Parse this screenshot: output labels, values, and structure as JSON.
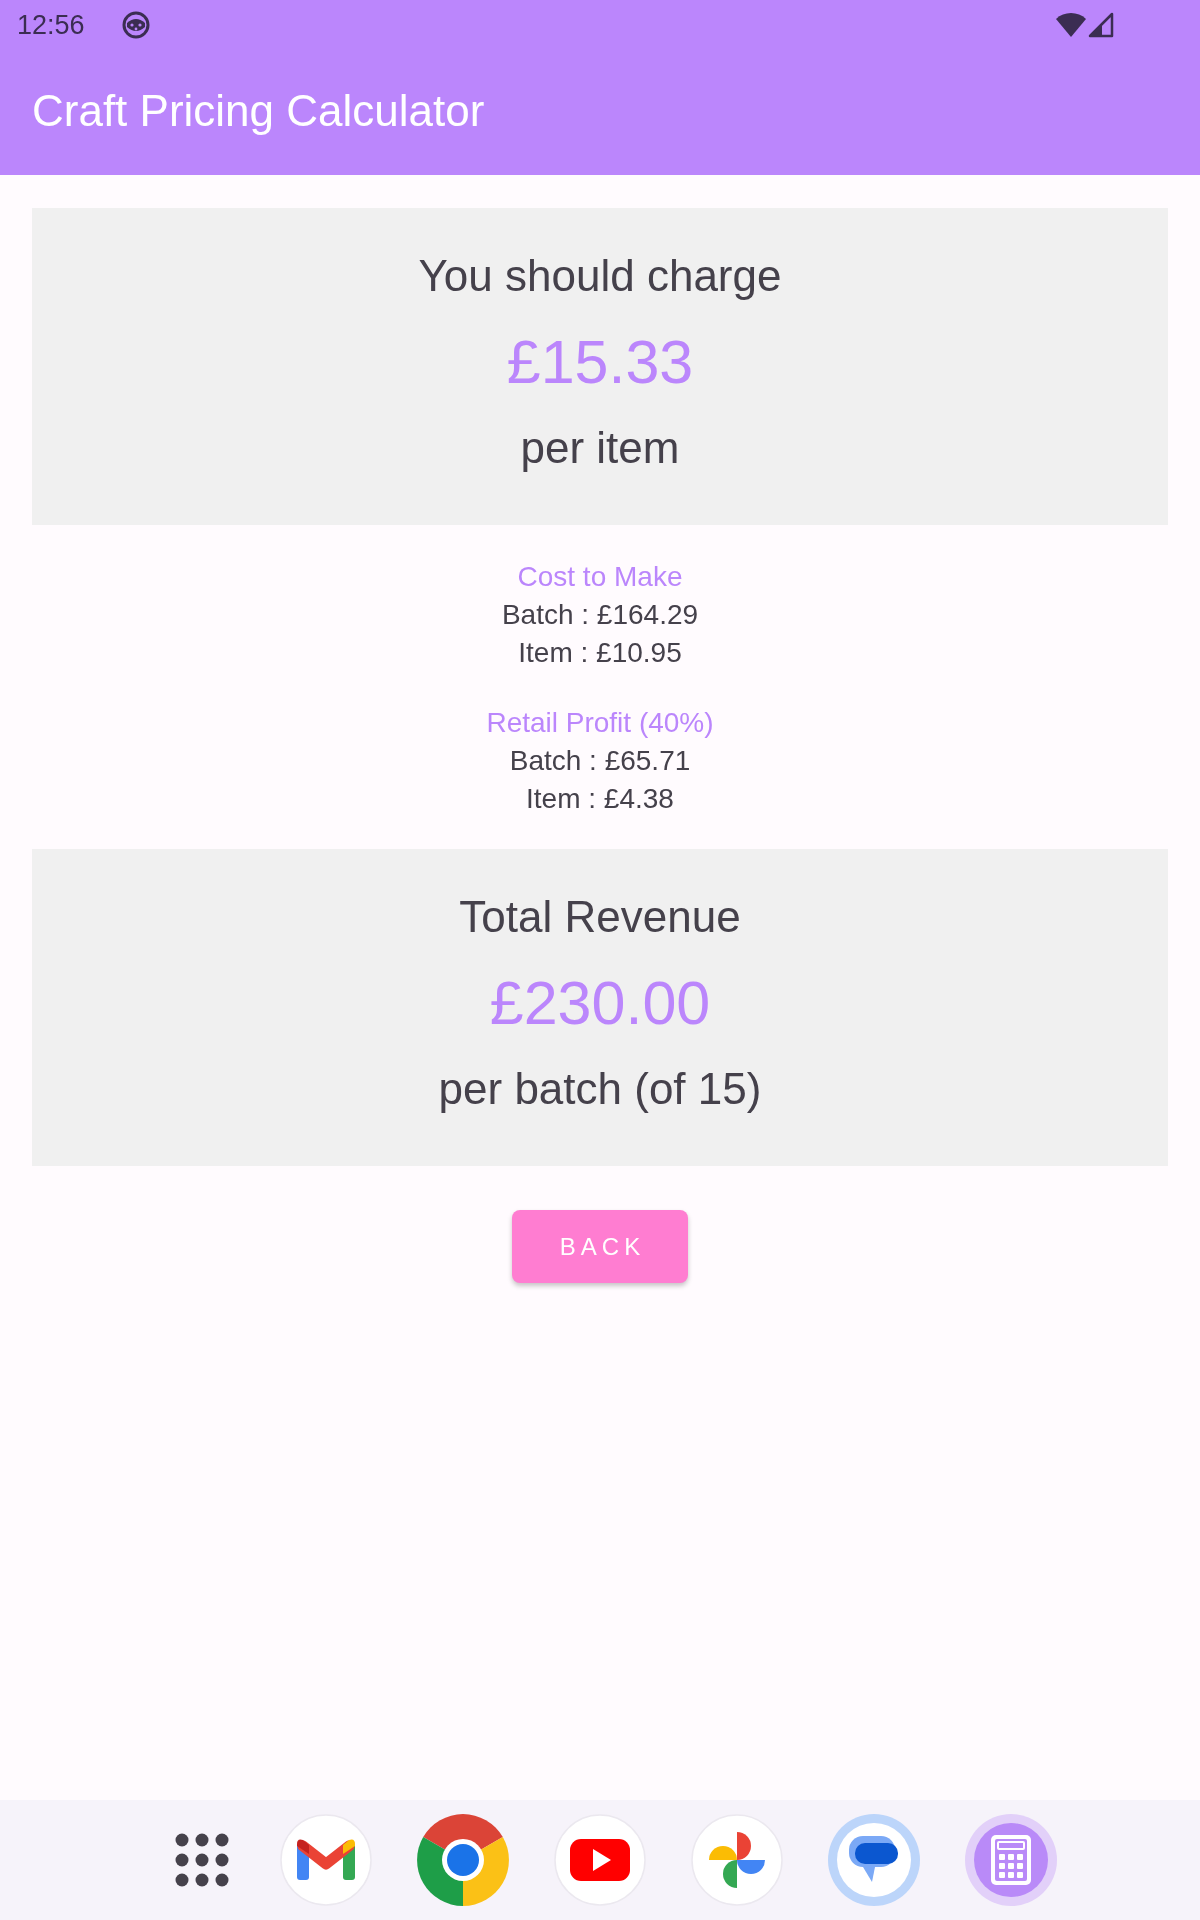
{
  "status_bar": {
    "time": "12:56"
  },
  "app_bar": {
    "title": "Craft Pricing Calculator"
  },
  "price_card": {
    "heading": "You should charge",
    "amount": "£15.33",
    "caption": "per item"
  },
  "breakdown": [
    {
      "title": "Cost to Make",
      "lines": [
        "Batch : £164.29",
        "Item : £10.95"
      ]
    },
    {
      "title": "Retail Profit (40%)",
      "lines": [
        "Batch : £65.71",
        "Item : £4.38"
      ]
    }
  ],
  "revenue_card": {
    "heading": "Total Revenue",
    "amount": "£230.00",
    "caption": "per batch (of 15)"
  },
  "back_button": {
    "label": "BACK"
  }
}
